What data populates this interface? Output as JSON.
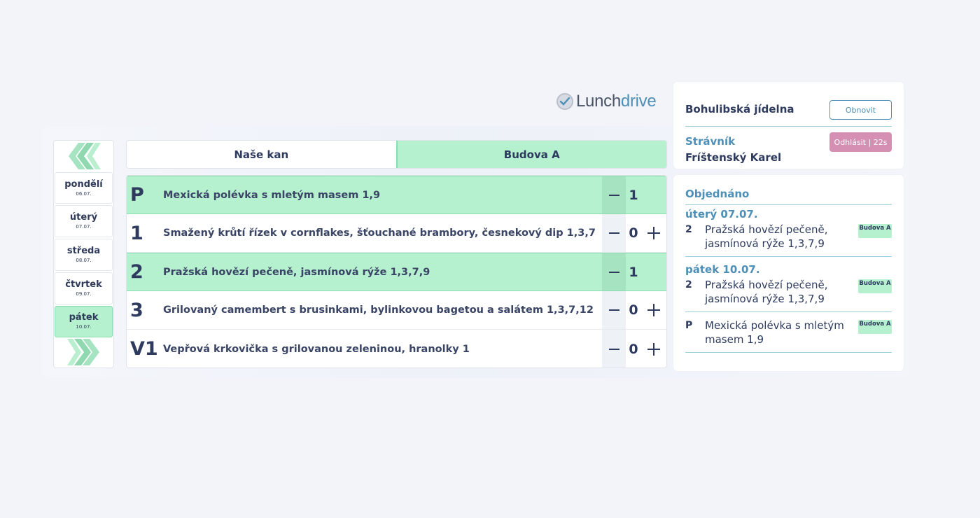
{
  "logo": {
    "part1": "Lunch",
    "part2": "drive"
  },
  "days": {
    "items": [
      {
        "name": "pondělí",
        "date": "06.07."
      },
      {
        "name": "úterý",
        "date": "07.07."
      },
      {
        "name": "středa",
        "date": "08.07."
      },
      {
        "name": "čtvrtek",
        "date": "09.07."
      },
      {
        "name": "pátek",
        "date": "10.07.",
        "active": true
      }
    ]
  },
  "tabs": [
    {
      "label": "Naše kan"
    },
    {
      "label": "Budova A",
      "active": true
    }
  ],
  "menu": [
    {
      "code": "P",
      "name": "Mexická polévka s mletým masem 1,9",
      "qty": "1",
      "selected": true
    },
    {
      "code": "1",
      "name": "Smažený krůtí řízek v cornflakes, šťouchané brambory, česnekový dip 1,3,7",
      "qty": "0"
    },
    {
      "code": "2",
      "name": "Pražská hovězí pečeně, jasmínová rýže 1,3,7,9",
      "qty": "1",
      "selected": true
    },
    {
      "code": "3",
      "name": "Grilovaný camembert s brusinkami, bylinkovou bagetou a salátem 1,3,7,12",
      "qty": "0"
    },
    {
      "code": "V1",
      "name": "Vepřová krkovička s grilovanou zeleninou, hranolky 1",
      "qty": "0"
    }
  ],
  "account": {
    "canteen": "Bohulibská jídelna",
    "refresh_label": "Obnovit",
    "diner_label": "Strávník",
    "diner_name": "Fríštenský Karel",
    "logout_label": "Odhlásit | 22s"
  },
  "orders": {
    "title": "Objednáno",
    "groups": [
      {
        "day": "úterý 07.07.",
        "code": "2",
        "name": "Pražská hovězí pečeně, jasmínová rýže 1,3,7,9",
        "badge": "Budova A"
      },
      {
        "day": "pátek 10.07.",
        "code": "2",
        "name": "Pražská hovězí pečeně, jasmínová rýže 1,3,7,9",
        "badge": "Budova A"
      },
      {
        "day": "",
        "code": "P",
        "name": "Mexická polévka s mletým masem 1,9",
        "badge": "Budova A"
      }
    ]
  },
  "colors": {
    "accent_green": "#b5f0cf",
    "accent_blue": "#4d8fb6",
    "logout_pink": "#d48fb3",
    "text_dark": "#2e3b5e"
  },
  "icons": {
    "day_prev": "chevrons-left-icon",
    "day_next": "chevrons-right-icon",
    "logo": "check-circle-icon"
  }
}
